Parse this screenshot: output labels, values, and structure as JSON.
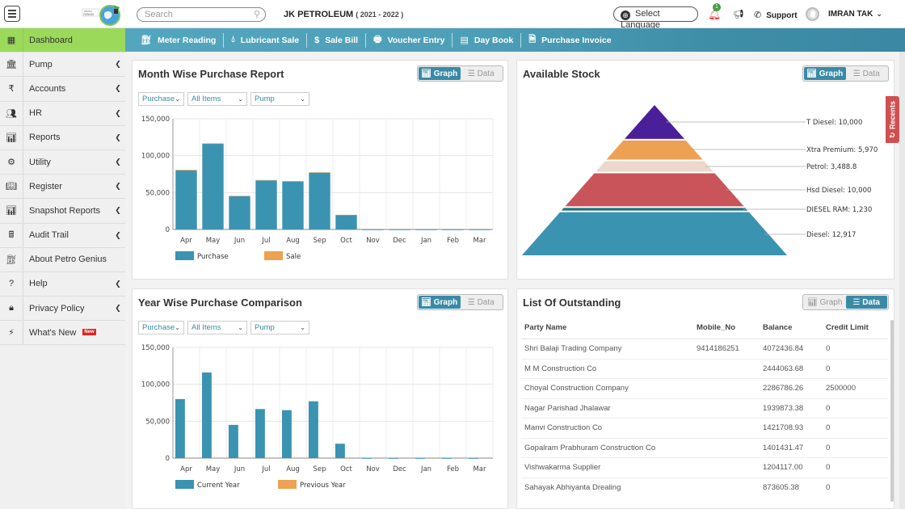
{
  "header": {
    "search_placeholder": "Search",
    "company_name": "JK PETROLEUM",
    "financial_year": "( 2021 - 2022 )",
    "select_language": "Select Language",
    "notification_count": "1",
    "support": "Support",
    "user_name": "IMRAN TAK"
  },
  "sidebar": {
    "items": [
      {
        "label": "Dashboard",
        "icon": "dashboard-icon",
        "glyph": "▦",
        "active": true,
        "chevron": false
      },
      {
        "label": "Pump",
        "icon": "bank-icon",
        "glyph": "🏛",
        "chevron": true
      },
      {
        "label": "Accounts",
        "icon": "rupee-icon",
        "glyph": "₹",
        "chevron": true
      },
      {
        "label": "HR",
        "icon": "users-icon",
        "glyph": "👥",
        "chevron": true
      },
      {
        "label": "Reports",
        "icon": "bar-chart-icon",
        "glyph": "📊",
        "chevron": true
      },
      {
        "label": "Utility",
        "icon": "cogs-icon",
        "glyph": "⚙",
        "chevron": true
      },
      {
        "label": "Register",
        "icon": "book-icon",
        "glyph": "📖",
        "chevron": true
      },
      {
        "label": "Snapshot Reports",
        "icon": "bar-chart-icon",
        "glyph": "📊",
        "chevron": true
      },
      {
        "label": "Audit Trail",
        "icon": "calculator-icon",
        "glyph": "🖩",
        "chevron": true
      },
      {
        "label": "About Petro Genius",
        "icon": "fuel-pump-icon",
        "glyph": "⛽",
        "chevron": false
      },
      {
        "label": "Help",
        "icon": "question-icon",
        "glyph": "?",
        "chevron": true
      },
      {
        "label": "Privacy Policy",
        "icon": "lock-icon",
        "glyph": "🔒",
        "chevron": true
      },
      {
        "label": "What's New",
        "icon": "bolt-icon",
        "glyph": "⚡",
        "chevron": false,
        "badge": "New"
      }
    ]
  },
  "quickbar": {
    "items": [
      {
        "label": "Meter Reading",
        "icon": "meter-icon",
        "glyph": "⛽"
      },
      {
        "label": "Lubricant Sale",
        "icon": "drop-icon",
        "glyph": "💧"
      },
      {
        "label": "Sale Bill",
        "icon": "hand-money-icon",
        "glyph": "$"
      },
      {
        "label": "Voucher Entry",
        "icon": "voucher-icon",
        "glyph": "🖶"
      },
      {
        "label": "Day Book",
        "icon": "book-icon",
        "glyph": "▤"
      },
      {
        "label": "Purchase Invoice",
        "icon": "invoice-icon",
        "glyph": "🗎"
      }
    ]
  },
  "toggle": {
    "graph": "Graph",
    "data": "Data"
  },
  "filters": {
    "type": "Purchase",
    "items": "All Items",
    "location": "Pump"
  },
  "month_panel": {
    "title": "Month Wise Purchase Report"
  },
  "stock_panel": {
    "title": "Available Stock"
  },
  "year_panel": {
    "title": "Year Wise Purchase Comparison"
  },
  "outstanding_panel": {
    "title": "List Of Outstanding",
    "columns": [
      "Party Name",
      "Mobile_No",
      "Balance",
      "Credit Limit"
    ],
    "rows": [
      [
        "Shri Balaji Trading Company",
        "9414186251",
        "4072436.84",
        "0"
      ],
      [
        "M M Construction Co",
        "",
        "2444063.68",
        "0"
      ],
      [
        "Choyal Construction Company",
        "",
        "2286786.26",
        "2500000"
      ],
      [
        "Nagar Parishad Jhalawar",
        "",
        "1939873.38",
        "0"
      ],
      [
        "Manvi Construction Co",
        "",
        "1421708.93",
        "0"
      ],
      [
        "Gopalram Prabhuram Construction Co",
        "",
        "1401431.47",
        "0"
      ],
      [
        "Vishwakarma Supplier",
        "",
        "1204117.00",
        "0"
      ],
      [
        "Sahayak Abhiyanta Drealing",
        "",
        "873605.38",
        "0"
      ]
    ]
  },
  "recents_label": "Recents",
  "colors": {
    "primary": "#3a8aa6",
    "accent_green": "#9bd95a",
    "bar": "#3a93b1",
    "sale": "#eda152"
  },
  "chart_data": [
    {
      "type": "bar",
      "title": "Month Wise Purchase Report",
      "stacked": true,
      "categories": [
        "Apr",
        "May",
        "Jun",
        "Jul",
        "Aug",
        "Sep",
        "Oct",
        "Nov",
        "Dec",
        "Jan",
        "Feb",
        "Mar"
      ],
      "series": [
        {
          "name": "Purchase",
          "color": "#3a93b1",
          "values": [
            80000,
            116000,
            45000,
            66500,
            65000,
            77000,
            19500,
            0,
            0,
            0,
            0,
            0
          ]
        },
        {
          "name": "Sale",
          "color": "#eda152",
          "values": [
            800,
            700,
            600,
            500,
            600,
            500,
            400,
            0,
            0,
            0,
            0,
            0
          ]
        }
      ],
      "yticks": [
        "0",
        "50,000",
        "100,000",
        "150,000"
      ],
      "ylim": [
        0,
        150000
      ],
      "legend": "bottom-left",
      "grid": true
    },
    {
      "type": "pyramid",
      "title": "Available Stock",
      "categories": [
        "T Diesel",
        "Xtra Premium",
        "Petrol",
        "Hsd Diesel",
        "DIESEL RAM",
        "Diesel"
      ],
      "labels": [
        "T Diesel: 10,000",
        "Xtra Premium: 5,970",
        "Petrol: 3,488.8",
        "Hsd Diesel: 10,000",
        "DIESEL RAM: 1,230",
        "Diesel: 12,917"
      ],
      "values": [
        10000,
        5970,
        3488.8,
        10000,
        1230,
        12917
      ],
      "colors": [
        "#4a1f9a",
        "#eda152",
        "#ead9cc",
        "#c9545a",
        "#1f6f86",
        "#3a93b1"
      ]
    },
    {
      "type": "bar",
      "title": "Year Wise Purchase Comparison",
      "categories": [
        "Apr",
        "May",
        "Jun",
        "Jul",
        "Aug",
        "Sep",
        "Oct",
        "Nov",
        "Dec",
        "Jan",
        "Feb",
        "Mar"
      ],
      "series": [
        {
          "name": "Current Year",
          "color": "#3a93b1",
          "values": [
            80000,
            116000,
            45000,
            66500,
            65000,
            77000,
            19500,
            0,
            0,
            0,
            0,
            0
          ]
        },
        {
          "name": "Previous Year",
          "color": "#eda152",
          "values": [
            0,
            0,
            0,
            0,
            0,
            0,
            0,
            0,
            0,
            0,
            0,
            0
          ]
        }
      ],
      "yticks": [
        "0",
        "50,000",
        "100,000",
        "150,000"
      ],
      "ylim": [
        0,
        150000
      ],
      "legend": "bottom-left",
      "grid": true
    }
  ]
}
